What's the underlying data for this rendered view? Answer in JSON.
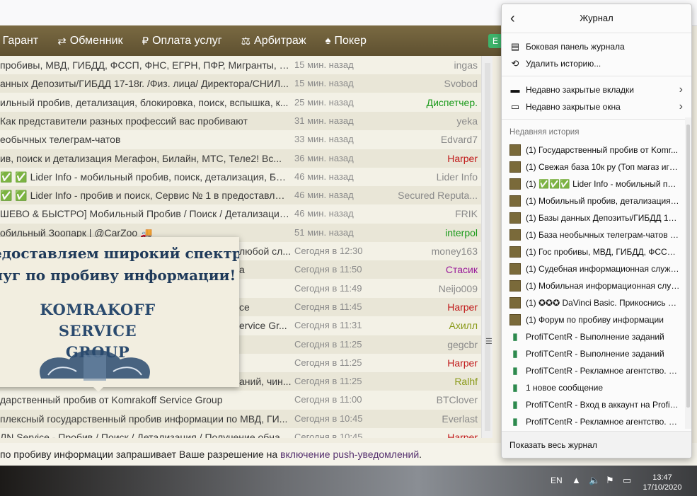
{
  "nav": {
    "items": [
      {
        "icon": "shield-icon",
        "label": "Гарант"
      },
      {
        "icon": "exchange-icon",
        "label": "Обменник"
      },
      {
        "icon": "ruble-icon",
        "label": "Оплата услуг"
      },
      {
        "icon": "scales-icon",
        "label": "Арбитраж"
      },
      {
        "icon": "poker-icon",
        "label": "Покер"
      }
    ]
  },
  "threads": [
    {
      "title": "пробивы, МВД, ГИБДД, ФССП, ФНС, ЕГРН, ПФР, Мигранты, Р...",
      "time": "15 мин. назад",
      "user": "ingas",
      "color": "#8a8a8a"
    },
    {
      "title": "анных Депозиты/ГИБДД 17-18г. /Физ. лица/ Директора/СНИЛ...",
      "time": "15 мин. назад",
      "user": "Svobod",
      "color": "#8a8a8a"
    },
    {
      "title": "ильный пробив, детализация, блокировка, поиск, вспышка, к...",
      "time": "25 мин. назад",
      "user": "Диспетчер.",
      "color": "#1a9a1a"
    },
    {
      "title": "Как представители разных профессий вас пробивают",
      "time": "31 мин. назад",
      "user": "yeka",
      "color": "#8a8a8a"
    },
    {
      "title": "еобычных телеграм-чатов",
      "time": "33 мин. назад",
      "user": "Edvard7",
      "color": "#8a8a8a"
    },
    {
      "title": "ив, поиск и детализация Мегафон, Билайн, МТС, Теле2! Вс...",
      "time": "36 мин. назад",
      "user": "Harper",
      "color": "#c01818"
    },
    {
      "title": "✅ ✅ Lider Info - мобильный пробив, поиск, детализация, БС, ...",
      "time": "46 мин. назад",
      "user": "Lider Info",
      "color": "#8a8a8a"
    },
    {
      "title": "✅ ✅ Lider Info - пробив и поиск, Сервис № 1 в предоставлен...",
      "time": "46 мин. назад",
      "user": "Secured Reputa...",
      "color": "#8a8a8a"
    },
    {
      "title": "ШЕВО & БЫСТРО] Мобильный Пробив / Поиск / Детализация...",
      "time": "46 мин. назад",
      "user": "FRIK",
      "color": "#8a8a8a"
    },
    {
      "title": "обильный Зоопарк | @CarZoo 🚚",
      "time": "51 мин. назад",
      "user": "interpol",
      "color": "#1a9a1a"
    },
    {
      "title": "любой сл...",
      "time": "Сегодня в 12:30",
      "user": "money163",
      "color": "#8a8a8a"
    },
    {
      "title": "а",
      "time": "Сегодня в 11:50",
      "user": "Стасик",
      "color": "#9a1a9a"
    },
    {
      "title": "",
      "time": "Сегодня в 11:49",
      "user": "Neijo009",
      "color": "#8a8a8a"
    },
    {
      "title": "ce",
      "time": "Сегодня в 11:45",
      "user": "Harper",
      "color": "#c01818"
    },
    {
      "title": "ervice Gr...",
      "time": "Сегодня в 11:31",
      "user": "Ахилл",
      "color": "#8a9a1a"
    },
    {
      "title": "",
      "time": "Сегодня в 11:25",
      "user": "gegcbr",
      "color": "#8a8a8a"
    },
    {
      "title": "",
      "time": "Сегодня в 11:25",
      "user": "Harper",
      "color": "#c01818"
    },
    {
      "title": "аний, чин...",
      "time": "Сегодня в 11:25",
      "user": "Ralhf",
      "color": "#8a9a1a"
    },
    {
      "title": "дарственный пробив от Komrakoff Service Group",
      "time": "Сегодня в 11:00",
      "user": "BTClover",
      "color": "#8a8a8a"
    },
    {
      "title": "плексный государственный пробив информации по МВД, ГИ...",
      "time": "Сегодня в 10:45",
      "user": "Everlast",
      "color": "#8a8a8a"
    },
    {
      "title": "ЛN Service - Пробив / Поиск / Детализация / Получение обнал...",
      "time": "Сегодня в 10:45",
      "user": "Harper",
      "color": "#c01818"
    }
  ],
  "popup": {
    "line1": "едоставляем широкий спектр",
    "line2": "луг по пробиву информации!",
    "logo1": "KOMRAKOFF",
    "logo2": "SERVICE GROUP"
  },
  "notification": {
    "text": "по пробиву информации запрашивает Ваше разрешение на ",
    "link": "включение push-уведомлений",
    "tail": "."
  },
  "taskbar": {
    "lang": "EN",
    "time": "13:47",
    "date": "17/10/2020"
  },
  "history": {
    "title": "Журнал",
    "actions": [
      {
        "icon": "sidebar-icon",
        "label": "Боковая панель журнала"
      },
      {
        "icon": "clock-icon",
        "label": "Удалить историю..."
      }
    ],
    "closed": [
      {
        "icon": "tab-icon",
        "label": "Недавно закрытые вкладки"
      },
      {
        "icon": "window-icon",
        "label": "Недавно закрытые окна"
      }
    ],
    "recent_label": "Недавняя история",
    "recent": [
      {
        "type": "img",
        "label": "(1) Государственный пробив от Komr..."
      },
      {
        "type": "img",
        "label": "(1) Свежая база 10к ру (Топ магаз игр..."
      },
      {
        "type": "img",
        "label": "(1) ✅✅✅ Lider Info - мобильный про..."
      },
      {
        "type": "img",
        "label": "(1) Мобильный пробив, детализация, ..."
      },
      {
        "type": "img",
        "label": "(1) Базы данных Депозиты/ГИБДД 17-..."
      },
      {
        "type": "img",
        "label": "(1) База необычных телеграм-чатов - ..."
      },
      {
        "type": "img",
        "label": "(1) Гос пробивы, МВД, ГИБДД, ФССП, ..."
      },
      {
        "type": "img",
        "label": "(1) Судебная информационная служб..."
      },
      {
        "type": "img",
        "label": "(1) Мобильная информационная служ..."
      },
      {
        "type": "img",
        "label": "(1) ✪✪✪ DaVinci Basic. Прикоснись к ..."
      },
      {
        "type": "img",
        "label": "(1) Форум по пробиву информации"
      },
      {
        "type": "bar",
        "label": "ProfiTCentR - Выполнение заданий"
      },
      {
        "type": "bar",
        "label": "ProfiTCentR - Выполнение заданий"
      },
      {
        "type": "bar",
        "label": "ProfiTCentR - Рекламное агентство. Э..."
      },
      {
        "type": "bar",
        "label": "1 новое сообщение"
      },
      {
        "type": "bar",
        "label": "ProfiTCentR - Вход в аккаунт на Profitc..."
      },
      {
        "type": "bar",
        "label": "ProfiTCentR - Рекламное агентство. Э..."
      }
    ],
    "footer": "Показать весь журнал"
  }
}
